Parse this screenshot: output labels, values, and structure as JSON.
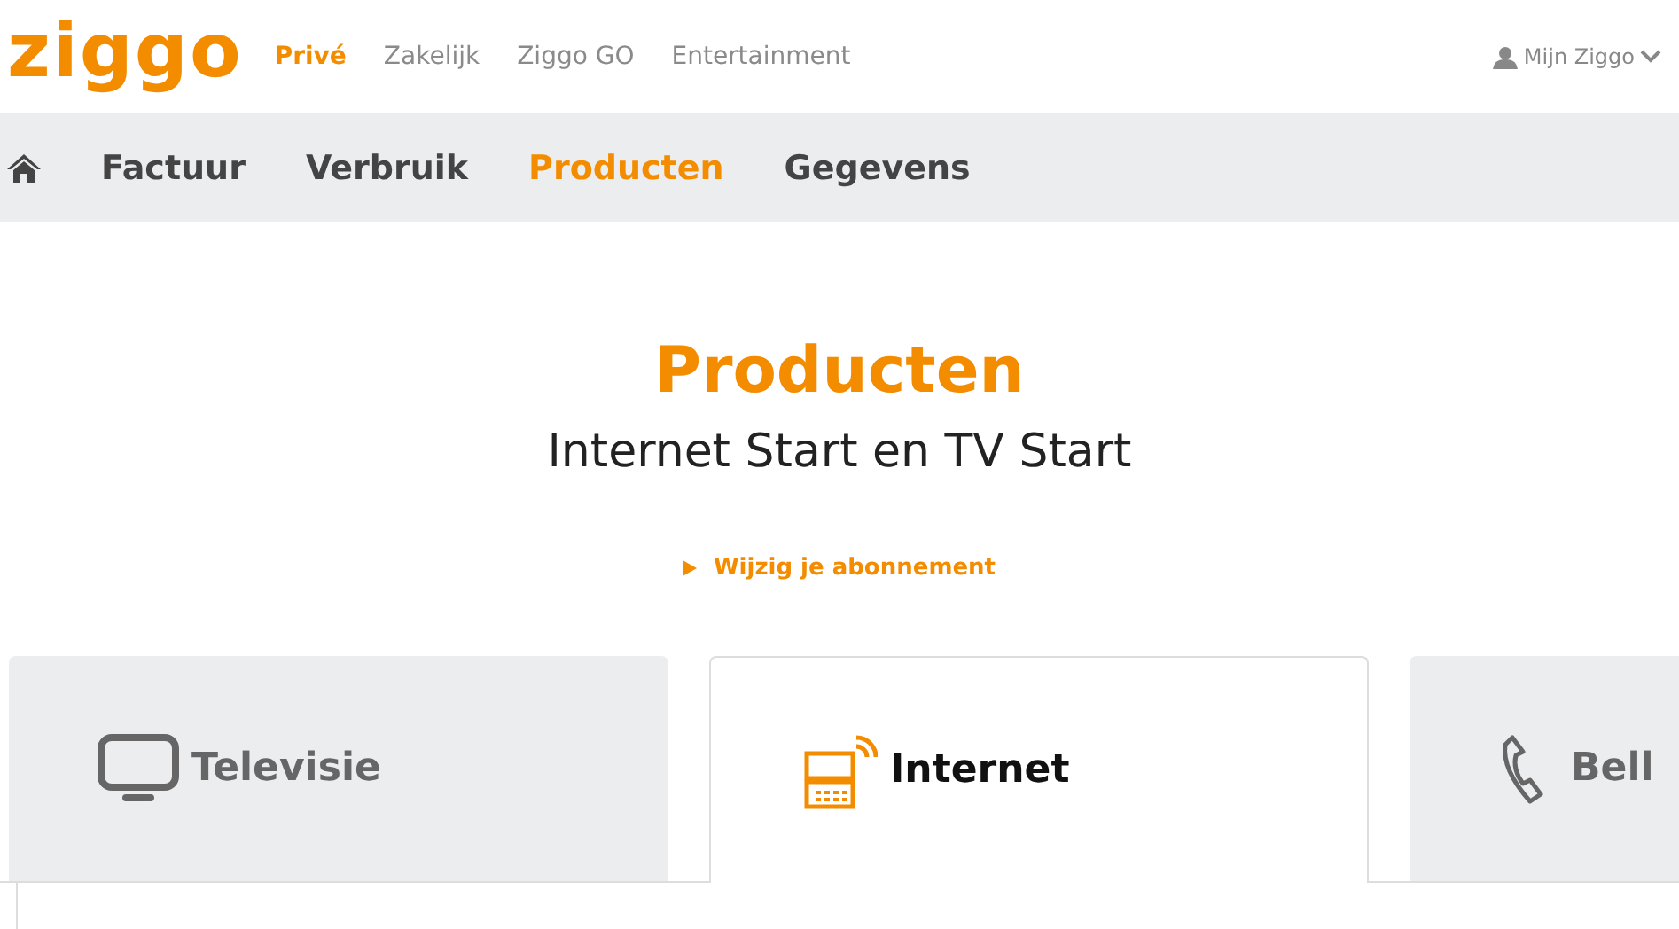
{
  "header": {
    "logo": "ziggo",
    "segments": [
      {
        "label": "Privé",
        "selected": true
      },
      {
        "label": "Zakelijk",
        "selected": false
      },
      {
        "label": "Ziggo GO",
        "selected": false
      },
      {
        "label": "Entertainment",
        "selected": false
      }
    ],
    "account": "Mijn Ziggo"
  },
  "nav": {
    "items": [
      {
        "label": "Factuur",
        "selected": false
      },
      {
        "label": "Verbruik",
        "selected": false
      },
      {
        "label": "Producten",
        "selected": true
      },
      {
        "label": "Gegevens",
        "selected": false
      }
    ]
  },
  "page": {
    "title": "Producten",
    "subtitle": "Internet Start en TV Start",
    "link": "Wijzig je abonnement"
  },
  "tabs": [
    {
      "kind": "tv",
      "label": "Televisie",
      "selected": false
    },
    {
      "kind": "internet",
      "label": "Internet",
      "selected": true
    },
    {
      "kind": "phone",
      "label": "Bell",
      "selected": false
    }
  ]
}
